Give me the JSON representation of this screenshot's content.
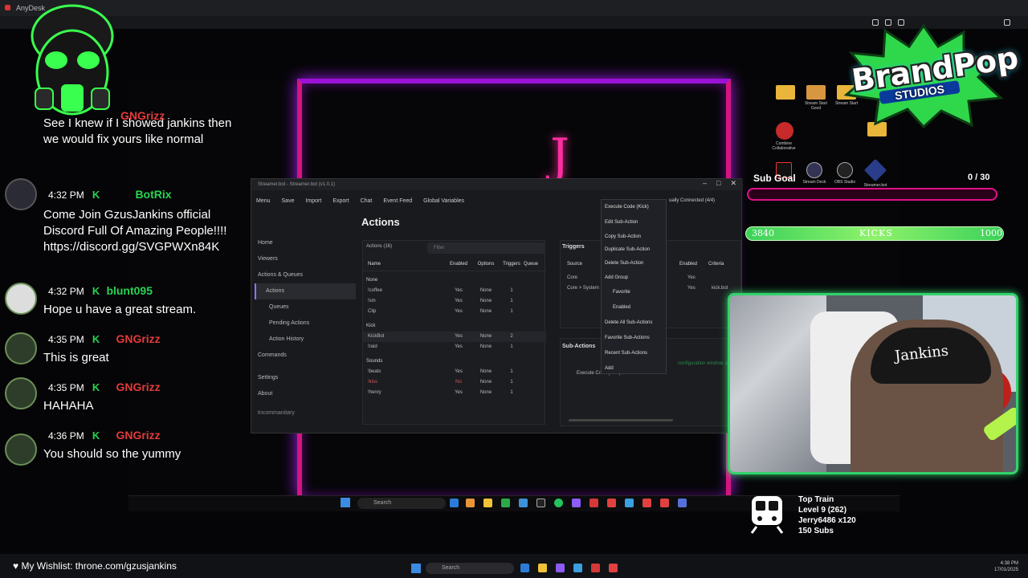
{
  "browser": {
    "tab_title": "AnyDesk"
  },
  "streamerbot": {
    "title": "Streamer.bot - Streamer.bot (v1.0.1)",
    "toolbar": [
      "Menu",
      "Save",
      "Import",
      "Export",
      "Chat",
      "Event Feed",
      "Global Variables"
    ],
    "connection": "ually Connected (4/4)",
    "nav": [
      "Home",
      "Viewers",
      "Actions & Queues",
      "Actions",
      "Queues",
      "Pending Actions",
      "Action History",
      "Commands",
      "Settings",
      "About"
    ],
    "nav_footer": "tncommanitary",
    "section_title": "Actions",
    "actions_count_label": "Actions (16)",
    "filter_placeholder": "Filter",
    "columns": [
      "Name",
      "Enabled",
      "Options",
      "Triggers",
      "Queue"
    ],
    "groups": [
      {
        "name": "None",
        "rows": [
          {
            "name": "!coffee",
            "enabled": "Yes",
            "options": "None",
            "triggers": "1"
          },
          {
            "name": "!sm",
            "enabled": "Yes",
            "options": "None",
            "triggers": "1"
          },
          {
            "name": "Clip",
            "enabled": "Yes",
            "options": "None",
            "triggers": "1"
          }
        ]
      },
      {
        "name": "Kick",
        "rows": [
          {
            "name": "KickBot",
            "enabled": "Yes",
            "options": "None",
            "triggers": "2"
          },
          {
            "name": "!raid",
            "enabled": "Yes",
            "options": "None",
            "triggers": "1"
          }
        ]
      },
      {
        "name": "Sounds",
        "rows": [
          {
            "name": "!beats",
            "enabled": "Yes",
            "options": "None",
            "triggers": "1"
          },
          {
            "name": "!kiss",
            "enabled": "No",
            "options": "None",
            "triggers": "1"
          },
          {
            "name": "!henry",
            "enabled": "Yes",
            "options": "None",
            "triggers": "1"
          }
        ]
      }
    ],
    "triggers": {
      "title": "Triggers",
      "columns": [
        "Source",
        "Enabled",
        "Criteria"
      ],
      "rows": [
        {
          "source": "Core",
          "enabled": "Yes",
          "criteria": ""
        },
        {
          "source": "Core > System",
          "enabled": "Yes",
          "criteria": "kick.bot"
        }
      ]
    },
    "sub_actions": {
      "title": "Sub-Actions",
      "item": "Execute Code (Kick)",
      "note": "configuration window, u"
    },
    "context_menu": [
      "Execute Code (Kick)",
      "Edit Sub-Action",
      "Copy Sub-Action",
      "Duplicate Sub-Action",
      "Delete Sub-Action",
      "Add Group",
      "Favorite",
      "Enabled",
      "Delete All Sub-Actions",
      "Favorite Sub-Actions",
      "Recent Sub-Actions",
      "Add"
    ]
  },
  "chat": [
    {
      "time": "",
      "user": "GNGrizz",
      "text": "See I knew if I showed jankins then we would fix yours like normal",
      "user_color": "#e23a3a"
    },
    {
      "time": "4:32 PM",
      "user": "BotRix",
      "text": "Come Join GzusJankins official Discord Full Of Amazing People!!!! https://discord.gg/SVGPWXn84K",
      "user_color": "#27d34f"
    },
    {
      "time": "4:32 PM",
      "user": "blunt095",
      "text": "Hope u have a great stream.",
      "user_color": "#27d34f"
    },
    {
      "time": "4:35 PM",
      "user": "GNGrizz",
      "text": "This is great",
      "user_color": "#e23a3a"
    },
    {
      "time": "4:35 PM",
      "user": "GNGrizz",
      "text": "HAHAHA",
      "user_color": "#e23a3a"
    },
    {
      "time": "4:36 PM",
      "user": "GNGrizz",
      "text": "You should so the yummy",
      "user_color": "#e23a3a"
    }
  ],
  "brand": {
    "title": "BrandPop",
    "subtitle": "STUDIOS"
  },
  "sub_goal": {
    "label": "Sub Goal",
    "value": "0 / 30",
    "progress": 0
  },
  "kicks": {
    "left": "3840",
    "center": "KICKS",
    "right": "1000"
  },
  "webcam": {
    "cap_text": "Jankins"
  },
  "train": {
    "line1": "Top Train",
    "line2": "Level 9 (262)",
    "line3": "Jerry6486 x120",
    "line4": "150 Subs"
  },
  "desktop_icons": [
    "",
    "Stream Start Good",
    "Stream Start",
    "Combine Collaborative",
    "",
    "TikTok Live Studio",
    "",
    "Stream Deck",
    "OBS Studio",
    "Streamer.bot"
  ],
  "remote_taskbar": {
    "search": "Search"
  },
  "bottom": {
    "wishlist": "My Wishlist: throne.com/gzusjankins",
    "search": "Search",
    "clock_time": "4:38 PM",
    "clock_date": "17/01/2025"
  }
}
